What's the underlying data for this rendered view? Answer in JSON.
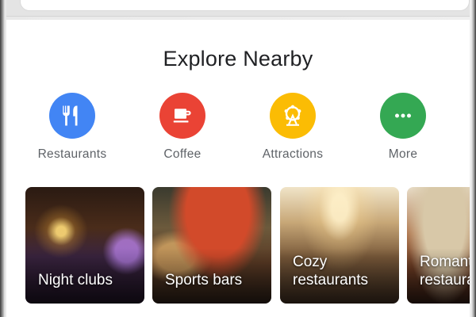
{
  "title": "Explore Nearby",
  "categories": [
    {
      "label": "Restaurants",
      "icon": "fork-knife-icon",
      "color": "#4285f4"
    },
    {
      "label": "Coffee",
      "icon": "coffee-cup-icon",
      "color": "#ea4335"
    },
    {
      "label": "Attractions",
      "icon": "ferris-wheel-icon",
      "color": "#fbbc04"
    },
    {
      "label": "More",
      "icon": "more-dots-icon",
      "color": "#34a853"
    }
  ],
  "tiles": [
    {
      "label": "Night clubs"
    },
    {
      "label": "Sports bars"
    },
    {
      "label": "Cozy restaurants"
    },
    {
      "label": "Romantic restaurants"
    }
  ]
}
